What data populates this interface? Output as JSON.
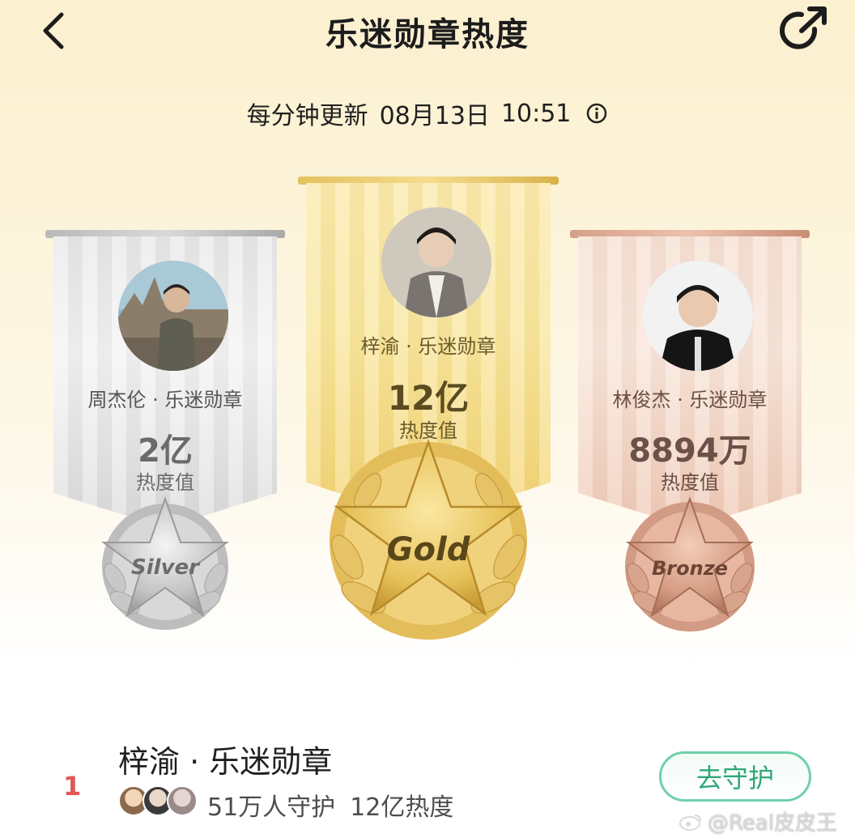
{
  "header": {
    "title": "乐迷勋章热度",
    "back_icon": "chevron-left-icon",
    "share_icon": "share-arrow-icon"
  },
  "update": {
    "label": "每分钟更新",
    "date": "08月13日",
    "time": "10:51",
    "info_icon": "info-circle-icon"
  },
  "podium": {
    "silver": {
      "name": "周杰伦 · 乐迷勋章",
      "value": "2亿",
      "label": "热度值",
      "medal": "Silver",
      "color": "#c9c9c9"
    },
    "gold": {
      "name": "梓渝 · 乐迷勋章",
      "value": "12亿",
      "label": "热度值",
      "medal": "Gold",
      "color": "#e9c35f"
    },
    "bronze": {
      "name": "林俊杰 · 乐迷勋章",
      "value": "8894万",
      "label": "热度值",
      "medal": "Bronze",
      "color": "#d9a08a"
    }
  },
  "ranking": [
    {
      "rank": "1",
      "title": "梓渝 · 乐迷勋章",
      "guardians": "51万人守护",
      "heat": "12亿热度",
      "action": "去守护"
    }
  ],
  "watermark": "@Real皮皮王",
  "colors": {
    "accent_green": "#2ea878",
    "rank_red": "#e05858"
  }
}
